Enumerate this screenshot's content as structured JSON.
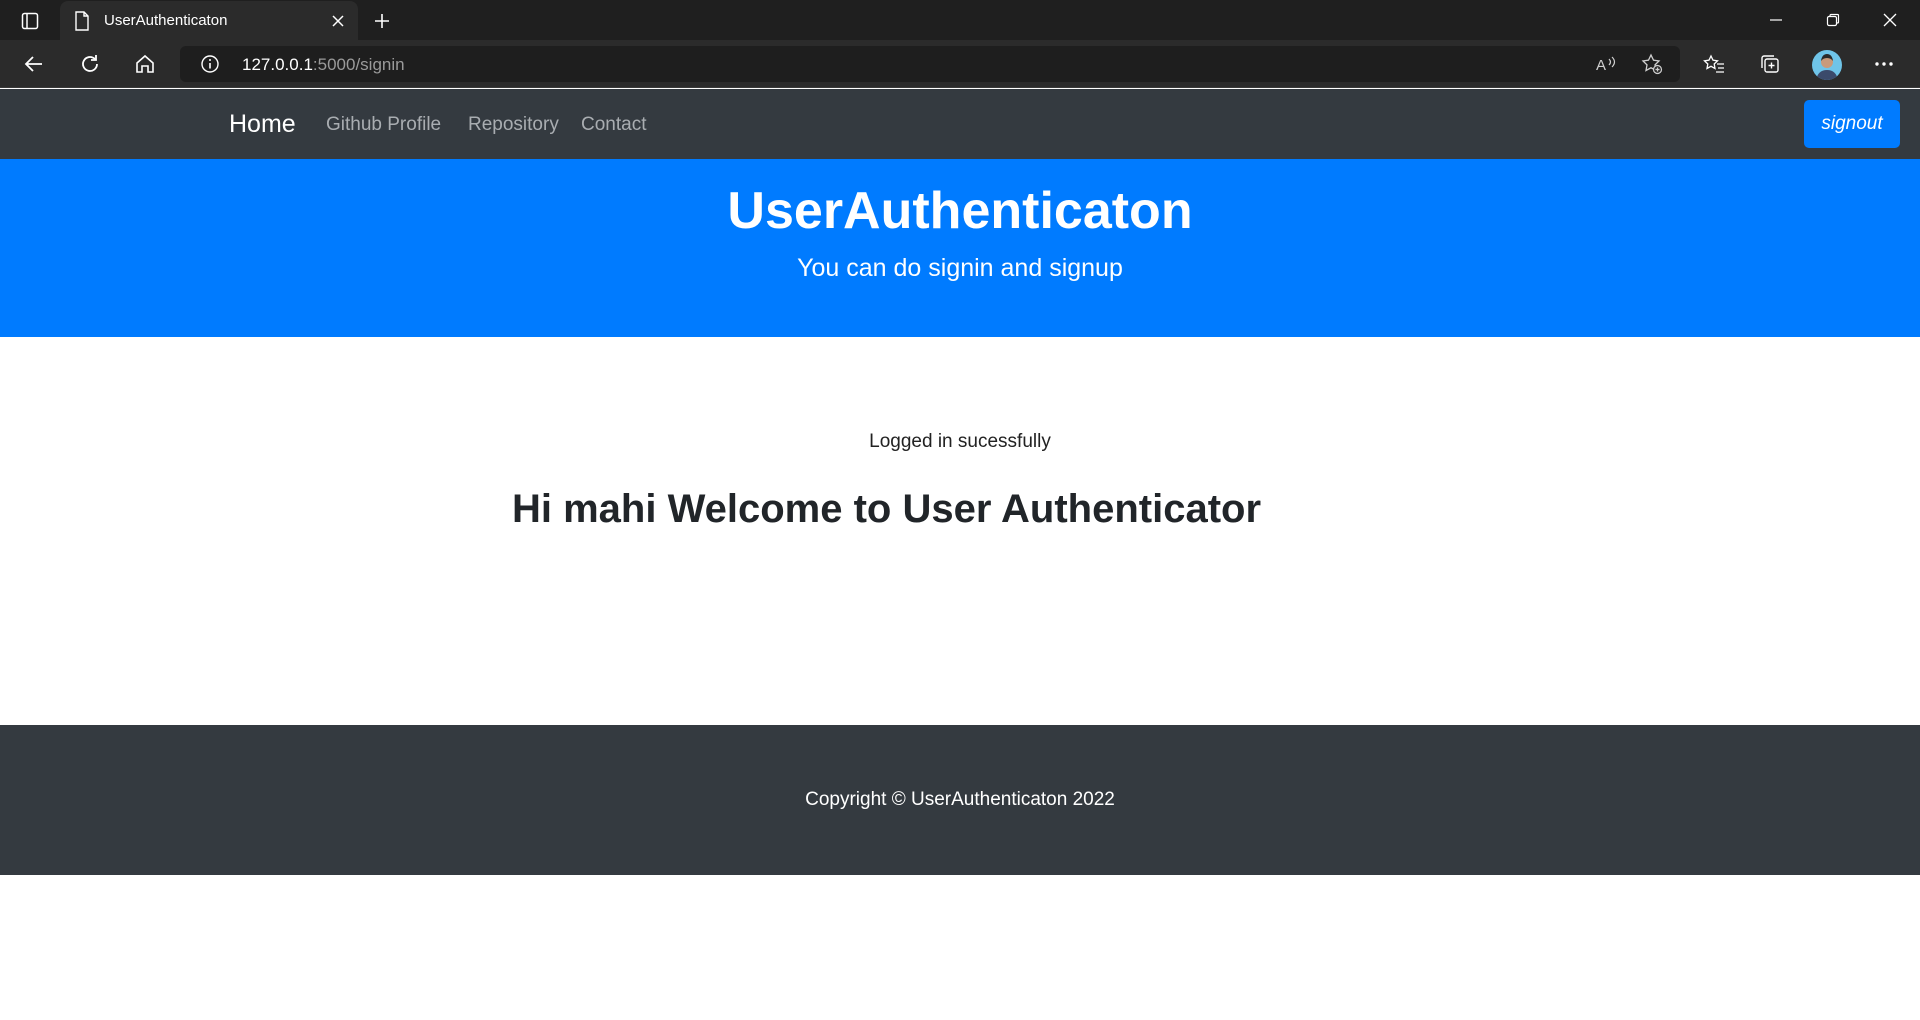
{
  "browser": {
    "tab_title": "UserAuthenticaton",
    "url_host": "127.0.0.1",
    "url_rest": ":5000/signin"
  },
  "navbar": {
    "brand": "Home",
    "links": [
      "Github Profile",
      "Repository",
      "Contact"
    ],
    "signout_label": "signout"
  },
  "hero": {
    "title": "UserAuthenticaton",
    "subtitle": "You can do signin and signup"
  },
  "main": {
    "flash_message": "Logged in sucessfully",
    "welcome": "Hi mahi Welcome to User Authenticator"
  },
  "footer": {
    "text": "Copyright © UserAuthenticaton 2022"
  },
  "colors": {
    "navbar": "#343a40",
    "accent": "#007bff",
    "footer": "#343a40"
  }
}
